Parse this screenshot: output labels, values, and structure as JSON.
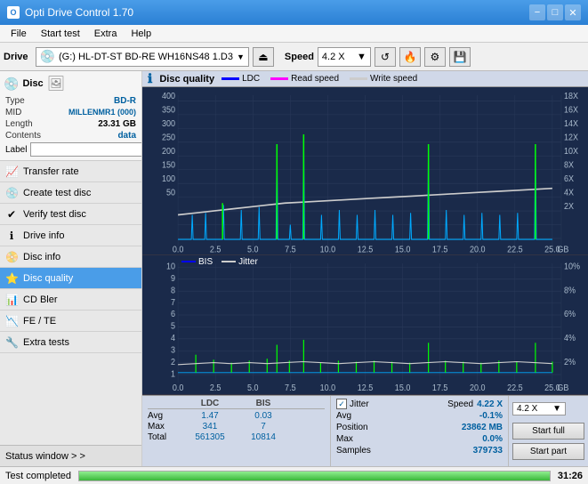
{
  "titlebar": {
    "title": "Opti Drive Control 1.70",
    "icon_text": "O",
    "minimize": "−",
    "maximize": "□",
    "close": "✕"
  },
  "menubar": {
    "items": [
      "File",
      "Start test",
      "Extra",
      "Help"
    ]
  },
  "toolbar": {
    "drive_label": "Drive",
    "drive_value": "(G:) HL-DT-ST BD-RE  WH16NS48 1.D3",
    "speed_label": "Speed",
    "speed_value": "4.2 X",
    "eject_icon": "⏏",
    "refresh_icon": "↺"
  },
  "disc_panel": {
    "title": "Disc",
    "type_label": "Type",
    "type_value": "BD-R",
    "mid_label": "MID",
    "mid_value": "MILLENMR1 (000)",
    "length_label": "Length",
    "length_value": "23.31 GB",
    "contents_label": "Contents",
    "contents_value": "data",
    "label_label": "Label"
  },
  "sidebar_nav": {
    "items": [
      {
        "label": "Transfer rate",
        "icon": "📈"
      },
      {
        "label": "Create test disc",
        "icon": "💿"
      },
      {
        "label": "Verify test disc",
        "icon": "✔"
      },
      {
        "label": "Drive info",
        "icon": "ℹ"
      },
      {
        "label": "Disc info",
        "icon": "📀"
      },
      {
        "label": "Disc quality",
        "icon": "⭐",
        "active": true
      },
      {
        "label": "CD Bler",
        "icon": "📊"
      },
      {
        "label": "FE / TE",
        "icon": "📉"
      },
      {
        "label": "Extra tests",
        "icon": "🔧"
      }
    ],
    "status_window": "Status window > >"
  },
  "chart": {
    "title": "Disc quality",
    "legend": {
      "ldc_label": "LDC",
      "ldc_color": "#0000ff",
      "read_label": "Read speed",
      "read_color": "#ff00ff",
      "write_label": "Write speed",
      "write_color": "#ffffff"
    },
    "top_chart": {
      "y_max": 400,
      "y_axis_right_max": "18X",
      "x_max": 25
    },
    "bottom_chart": {
      "legend_bis": "BIS",
      "legend_jitter": "Jitter",
      "y_max": 10,
      "y_axis_right_max": "10%",
      "x_max": 25
    }
  },
  "stats": {
    "headers": [
      "LDC",
      "BIS",
      "",
      "Jitter",
      "Speed",
      ""
    ],
    "avg_label": "Avg",
    "avg_ldc": "1.47",
    "avg_bis": "0.03",
    "avg_jitter": "-0.1%",
    "max_label": "Max",
    "max_ldc": "341",
    "max_bis": "7",
    "max_jitter": "0.0%",
    "total_label": "Total",
    "total_ldc": "561305",
    "total_bis": "10814",
    "speed_label": "Speed",
    "speed_value": "4.22 X",
    "position_label": "Position",
    "position_value": "23862 MB",
    "samples_label": "Samples",
    "samples_value": "379733",
    "speed_select": "4.2 X",
    "start_full_btn": "Start full",
    "start_part_btn": "Start part",
    "jitter_checkbox_checked": "✓"
  },
  "statusbar": {
    "text": "Test completed",
    "progress": 100,
    "time": "31:26"
  }
}
